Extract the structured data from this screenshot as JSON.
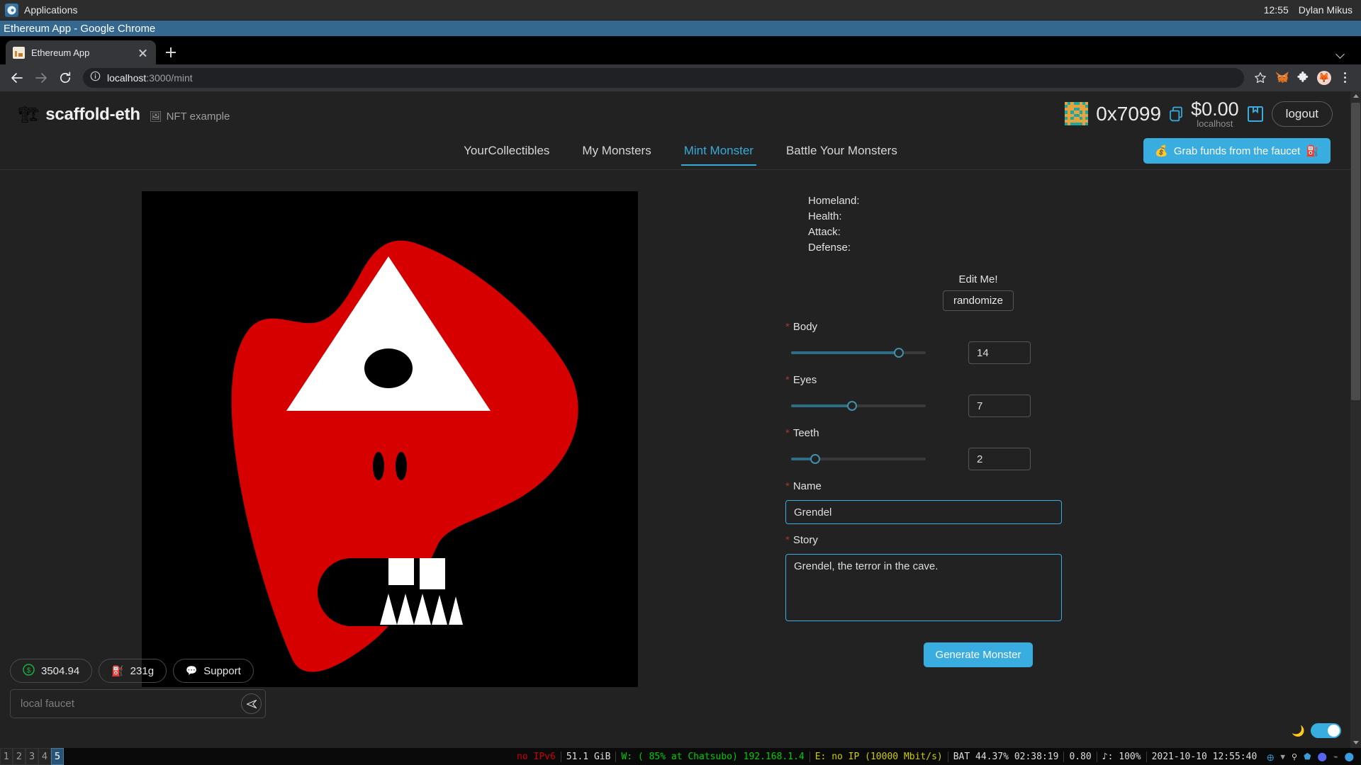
{
  "desktop": {
    "applications_label": "Applications",
    "applications_icon": "xfce-mouse-icon",
    "clock": "12:55",
    "user": "Dylan Mikus",
    "window_title": "Ethereum App - Google Chrome"
  },
  "browser": {
    "tab": {
      "title": "Ethereum App",
      "favicon": "page-favicon",
      "close_icon": "close-icon"
    },
    "new_tab_icon": "plus-icon",
    "tab_list_icon": "chevron-down-icon",
    "back_icon": "back-arrow-icon",
    "forward_icon": "forward-arrow-icon",
    "reload_icon": "reload-icon",
    "site_info_icon": "info-circle-icon",
    "url_host": "localhost",
    "url_path": ":3000/mint",
    "url_full": "localhost:3000/mint",
    "bookmark_icon": "star-icon",
    "metamask_icon": "metamask-fox-icon",
    "extensions_icon": "puzzle-piece-icon",
    "profile_icon": "profile-avatar-icon",
    "menu_icon": "three-dots-menu-icon"
  },
  "site": {
    "brand": {
      "emoji": "🏗",
      "name": "scaffold-eth",
      "sub_emoji": "🖼",
      "sub_label": "NFT example"
    },
    "account": {
      "address": "0x7099",
      "copy_icon": "copy-icon",
      "balance": "$0.00",
      "network": "localhost",
      "wallet_icon": "wallet-save-icon",
      "logout_label": "logout",
      "blockie": {
        "bg": "#e8a33d",
        "fg": "#1ca8a0",
        "pattern": [
          [
            0,
            1,
            0,
            1,
            1,
            0,
            1,
            0
          ],
          [
            1,
            0,
            0,
            0,
            0,
            0,
            0,
            1
          ],
          [
            0,
            0,
            0,
            1,
            1,
            0,
            0,
            0
          ],
          [
            1,
            0,
            1,
            0,
            0,
            1,
            0,
            1
          ],
          [
            0,
            0,
            0,
            1,
            1,
            0,
            0,
            0
          ],
          [
            1,
            0,
            1,
            0,
            0,
            1,
            0,
            1
          ],
          [
            0,
            0,
            0,
            0,
            0,
            0,
            0,
            0
          ],
          [
            1,
            0,
            1,
            1,
            1,
            1,
            0,
            1
          ]
        ]
      }
    },
    "nav_tabs": [
      {
        "label": "YourCollectibles",
        "active": false
      },
      {
        "label": "My Monsters",
        "active": false
      },
      {
        "label": "Mint Monster",
        "active": true
      },
      {
        "label": "Battle Your Monsters",
        "active": false
      }
    ],
    "faucet_button": {
      "emoji_left": "💰",
      "label": "Grab funds from the faucet",
      "emoji_right": "⛽"
    },
    "accent_color": "#39ace0"
  },
  "mint_form": {
    "stats": [
      {
        "label": "Homeland:",
        "value": ""
      },
      {
        "label": "Health:",
        "value": ""
      },
      {
        "label": "Attack:",
        "value": ""
      },
      {
        "label": "Defense:",
        "value": ""
      }
    ],
    "edit_me_label": "Edit Me!",
    "randomize_label": "randomize",
    "sliders": [
      {
        "label": "Body",
        "value": "14",
        "required": true,
        "percent": 80
      },
      {
        "label": "Eyes",
        "value": "7",
        "required": true,
        "percent": 45
      },
      {
        "label": "Teeth",
        "value": "2",
        "required": true,
        "percent": 18
      }
    ],
    "name_field": {
      "label": "Name",
      "value": "Grendel",
      "required": true
    },
    "story_field": {
      "label": "Story",
      "value": "Grendel, the terror in the cave.",
      "required": true
    },
    "generate_label": "Generate Monster"
  },
  "monster": {
    "body_color": "#d60000",
    "canvas_bg": "#000000",
    "eye_fill": "#ffffff",
    "pupil_fill": "#000000",
    "mouth_fill": "#000000",
    "teeth_fill": "#ffffff",
    "upper_teeth_count": 2,
    "lower_teeth_count": 5,
    "nostril_count": 2
  },
  "bottom_widgets": {
    "price": {
      "icon": "dollar-circle-icon",
      "value": "3504.94"
    },
    "gas": {
      "icon": "gas-pump-icon",
      "value": "231g"
    },
    "support": {
      "icon": "speech-bubble-icon",
      "label": "Support"
    },
    "faucet_input": {
      "placeholder": "local faucet",
      "value": "",
      "send_icon": "send-paper-plane-icon"
    },
    "theme_toggle": {
      "moon_icon": "moon-icon",
      "state": "on"
    }
  },
  "statusbar": {
    "workspaces": [
      {
        "label": "1",
        "active": false
      },
      {
        "label": "2",
        "active": false
      },
      {
        "label": "3",
        "active": false
      },
      {
        "label": "4",
        "active": false
      },
      {
        "label": "5",
        "active": true
      }
    ],
    "segments": [
      {
        "text": "no IPv6",
        "color": "#cc0000"
      },
      {
        "text": "51.1 GiB",
        "color": "#ffffff"
      },
      {
        "text": "W: ( 85% at Chatsubo) 192.168.1.4",
        "color": "#00cc00"
      },
      {
        "text": "E: no IP (10000 Mbit/s)",
        "color": "#cccc00"
      },
      {
        "text": "BAT 44.37% 02:38:19",
        "color": "#ffffff"
      },
      {
        "text": "0.80",
        "color": "#ffffff"
      },
      {
        "text": "♪: 100%",
        "color": "#ffffff"
      },
      {
        "text": "2021-10-10 12:55:40",
        "color": "#ffffff"
      }
    ],
    "tray_icons": [
      "bluetooth-icon",
      "wifi-icon",
      "location-icon",
      "shield-icon",
      "discord-icon",
      "mute-bell-icon",
      "droplet-icon"
    ]
  }
}
